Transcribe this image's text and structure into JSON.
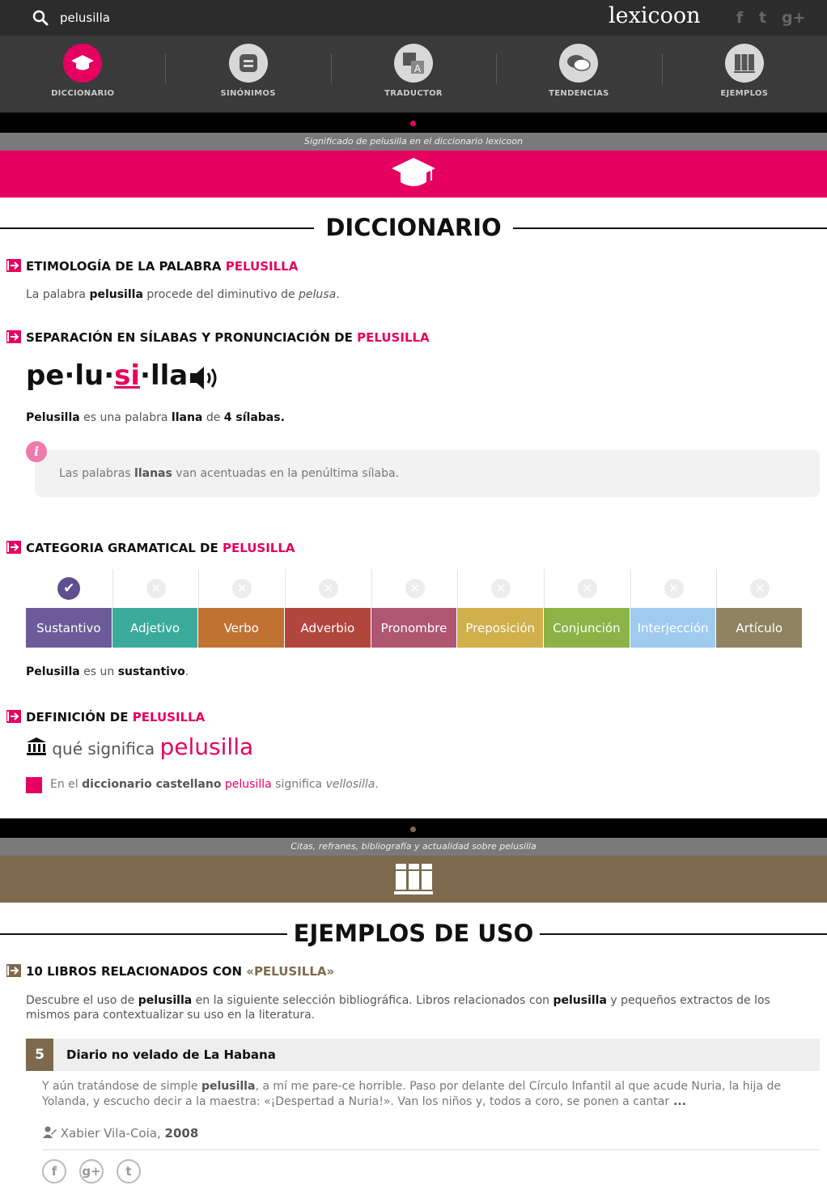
{
  "search": {
    "query": "pelusilla"
  },
  "brand": {
    "logo": "lexicoon",
    "accent": "#e6005f",
    "brown": "#7d6a4d"
  },
  "social_top": [
    "f",
    "t",
    "g+"
  ],
  "nav": [
    {
      "label": "DICCIONARIO",
      "icon": "graduation-cap-icon",
      "active": true
    },
    {
      "label": "SINÓNIMOS",
      "icon": "synonyms-icon"
    },
    {
      "label": "TRADUCTOR",
      "icon": "translate-icon"
    },
    {
      "label": "TENDENCIAS",
      "icon": "chat-bubbles-icon"
    },
    {
      "label": "EJEMPLOS",
      "icon": "books-icon"
    }
  ],
  "dict": {
    "strip": "Significado de pelusilla en el diccionario lexicoon",
    "title": "DICCIONARIO"
  },
  "etym": {
    "heading": "ETIMOLOGÍA DE LA PALABRA",
    "kw": "PELUSILLA",
    "t1": "La palabra ",
    "b1": "pelusilla",
    "t2": " procede del diminutivo de ",
    "i1": "pelusa",
    "t3": "."
  },
  "sil": {
    "heading": "SEPARACIÓN EN SÍLABAS Y PRONUNCIACIÓN DE",
    "kw": "PELUSILLA",
    "s1": "pe",
    "s2": "lu",
    "s3": "si",
    "s4": "lla",
    "dot": "·",
    "word": "Pelusilla",
    "t1": " es una palabra ",
    "b1": "llana",
    "t2": " de ",
    "b2": "4 sílabas.",
    "info_icon": "i",
    "info_t1": "Las palabras ",
    "info_b1": "llanas",
    "info_t2": " van acentuadas en la penúltima sílaba."
  },
  "cat": {
    "heading": "CATEGORIA GRAMATICAL DE",
    "kw": "PELUSILLA",
    "items": [
      {
        "label": "Sustantivo",
        "color": "#6b5c99",
        "active": true
      },
      {
        "label": "Adjetivo",
        "color": "#3aaa9b"
      },
      {
        "label": "Verbo",
        "color": "#c07233"
      },
      {
        "label": "Adverbio",
        "color": "#b2463e"
      },
      {
        "label": "Pronombre",
        "color": "#ae5672"
      },
      {
        "label": "Preposición",
        "color": "#cfb04a"
      },
      {
        "label": "Conjunción",
        "color": "#8bb345"
      },
      {
        "label": "Interjección",
        "color": "#9fcbee"
      },
      {
        "label": "Artículo",
        "color": "#8f8362"
      }
    ],
    "check": "✔",
    "x": "✕",
    "word": "Pelusilla",
    "t1": " es un ",
    "b1": "sustantivo",
    "t2": "."
  },
  "def": {
    "heading": "DEFINICIÓN DE",
    "kw": "PELUSILLA",
    "q": " qué significa ",
    "word": "pelusilla",
    "t1": "En el ",
    "b1": "diccionario castellano",
    "w": " pelusilla",
    "t2": " significa ",
    "i1": "vellosilla",
    "t3": "."
  },
  "ex": {
    "strip": "Citas, refranes, bibliografía y actualidad sobre pelusilla",
    "title": "EJEMPLOS DE USO"
  },
  "books": {
    "heading": "10 LIBROS RELACIONADOS CON",
    "kw": "«PELUSILLA»",
    "d1": "Descubre el uso de ",
    "db1": "pelusilla",
    "d2": " en la siguiente selección bibliográfica. Libros relacionados con ",
    "db2": "pelusilla",
    "d3": " y pequeños extractos de los",
    "d4": "mismos para contextualizar su uso en la literatura.",
    "num": "5",
    "title": "Diario no velado de La Habana",
    "e1": "Y aún tratándose de simple ",
    "eb1": "pelusilla",
    "e2": ", a mí me pare-ce horrible. Paso por delante del Círculo Infantil al que acude Nuria, la hija de Yolanda, y escucho decir a la maestra: «¡Despertad a Nuria!». Van los niños y, todos a coro, se ponen a cantar",
    "more": " ...",
    "author": " Xabier Vila-Coia, ",
    "year": "2008",
    "share": [
      "f",
      "g+",
      "t"
    ]
  }
}
